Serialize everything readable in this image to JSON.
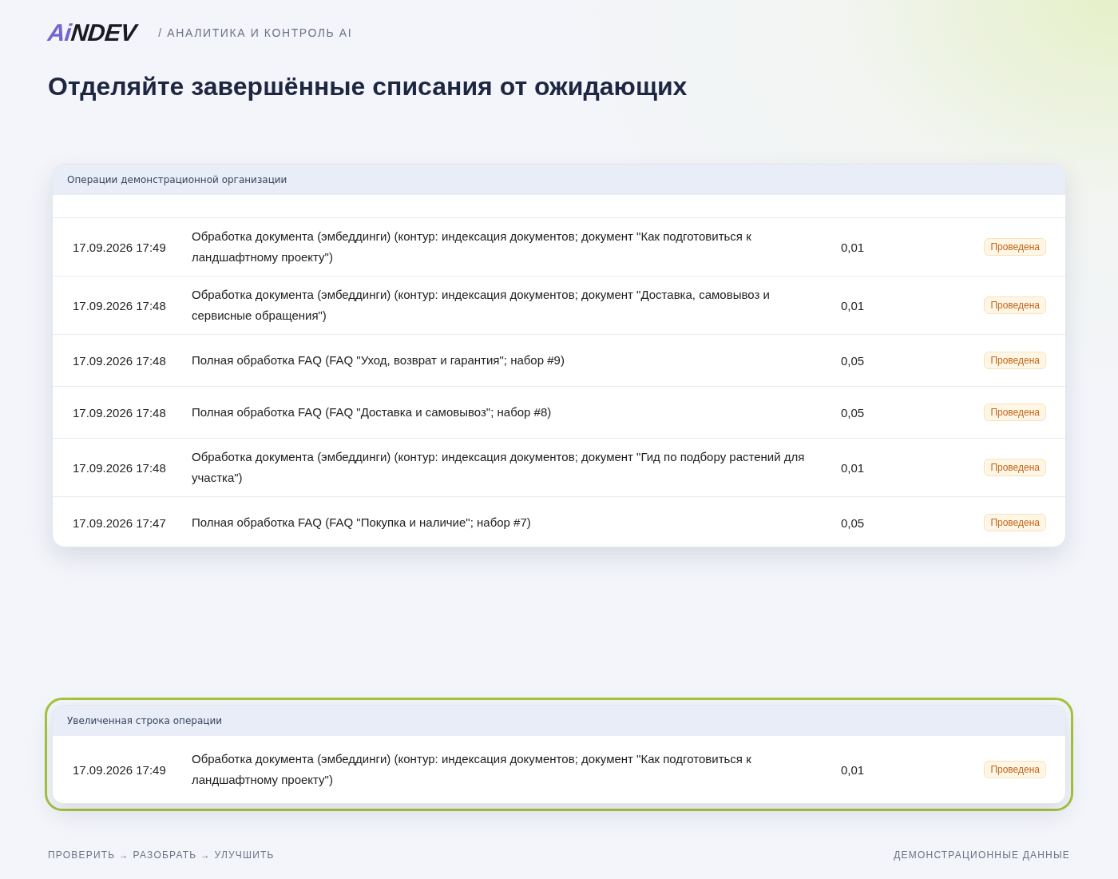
{
  "logo": {
    "accent": "Ai",
    "rest": "NDEV"
  },
  "breadcrumb": "/ АНАЛИТИКА И КОНТРОЛЬ AI",
  "title": "Отделяйте завершённые списания от ожидающих",
  "operations_table": {
    "caption": "Операции демонстрационной организации",
    "rows": [
      {
        "date": "17.09.2026 17:49",
        "description": "Обработка документа (эмбеддинги) (контур: индексация документов; документ \"Как подготовиться к ландшафтному проекту\")",
        "amount": "0,01",
        "status": {
          "label": "Проведена",
          "kind": "done"
        }
      },
      {
        "date": "17.09.2026 17:48",
        "description": "Обработка документа (эмбеддинги) (контур: индексация документов; документ \"Доставка, самовывоз и сервисные обращения\")",
        "amount": "0,01",
        "status": {
          "label": "Проведена",
          "kind": "done"
        }
      },
      {
        "date": "17.09.2026 17:48",
        "description": "Полная обработка FAQ (FAQ \"Уход, возврат и гарантия\"; набор #9)",
        "amount": "0,05",
        "status": {
          "label": "Проведена",
          "kind": "done"
        }
      },
      {
        "date": "17.09.2026 17:48",
        "description": "Полная обработка FAQ (FAQ \"Доставка и самовывоз\"; набор #8)",
        "amount": "0,05",
        "status": {
          "label": "Проведена",
          "kind": "done"
        }
      },
      {
        "date": "17.09.2026 17:48",
        "description": "Обработка документа (эмбеддинги) (контур: индексация документов; документ \"Гид по подбору растений для участка\")",
        "amount": "0,01",
        "status": {
          "label": "Проведена",
          "kind": "done"
        }
      },
      {
        "date": "17.09.2026 17:47",
        "description": "Полная обработка FAQ (FAQ \"Покупка и наличие\"; набор #7)",
        "amount": "0,05",
        "status": {
          "label": "Проведена",
          "kind": "done"
        }
      }
    ]
  },
  "zoomed_row": {
    "caption": "Увеличенная строка операции",
    "rows": [
      {
        "date": "17.09.2026 17:49",
        "description": "Обработка документа (эмбеддинги) (контур: индексация документов; документ \"Как подготовиться к ландшафтному проекту\")",
        "amount": "0,01",
        "status": {
          "label": "Проведена",
          "kind": "done"
        }
      }
    ]
  },
  "footer": {
    "left": "ПРОВЕРИТЬ → РАЗОБРАТЬ → УЛУЧШИТЬ",
    "right": "ДЕМОНСТРАЦИОННЫЕ ДАННЫЕ"
  }
}
